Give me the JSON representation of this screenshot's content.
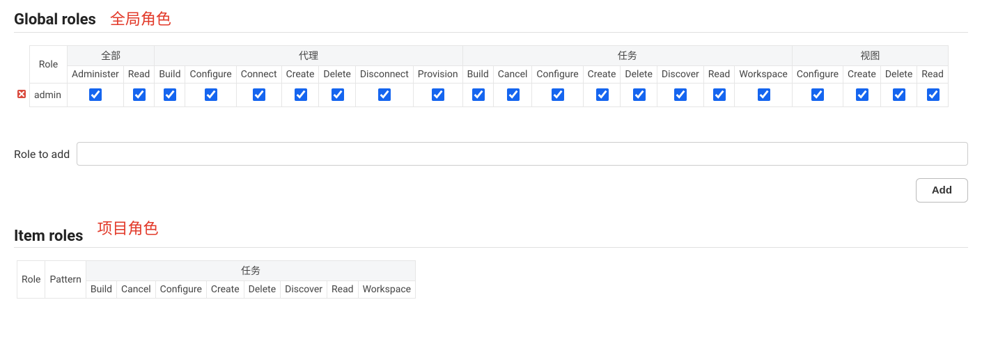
{
  "global": {
    "title": "Global roles",
    "annotation": "全局角色",
    "role_header": "Role",
    "groups": [
      {
        "label": "全部",
        "perms": [
          "Administer",
          "Read"
        ]
      },
      {
        "label": "代理",
        "perms": [
          "Build",
          "Configure",
          "Connect",
          "Create",
          "Delete",
          "Disconnect",
          "Provision"
        ]
      },
      {
        "label": "任务",
        "perms": [
          "Build",
          "Cancel",
          "Configure",
          "Create",
          "Delete",
          "Discover",
          "Read",
          "Workspace"
        ]
      },
      {
        "label": "视图",
        "perms": [
          "Configure",
          "Create",
          "Delete",
          "Read"
        ]
      }
    ],
    "rows": [
      {
        "name": "admin",
        "checks": [
          true,
          true,
          true,
          true,
          true,
          true,
          true,
          true,
          true,
          true,
          true,
          true,
          true,
          true,
          true,
          true,
          true,
          true,
          true,
          true,
          true
        ]
      }
    ],
    "add_label": "Role to add",
    "add_value": "",
    "add_button": "Add"
  },
  "item": {
    "title": "Item roles",
    "annotation": "项目角色",
    "role_header": "Role",
    "pattern_header": "Pattern",
    "groups": [
      {
        "label": "任务",
        "perms": [
          "Build",
          "Cancel",
          "Configure",
          "Create",
          "Delete",
          "Discover",
          "Read",
          "Workspace"
        ]
      }
    ]
  }
}
